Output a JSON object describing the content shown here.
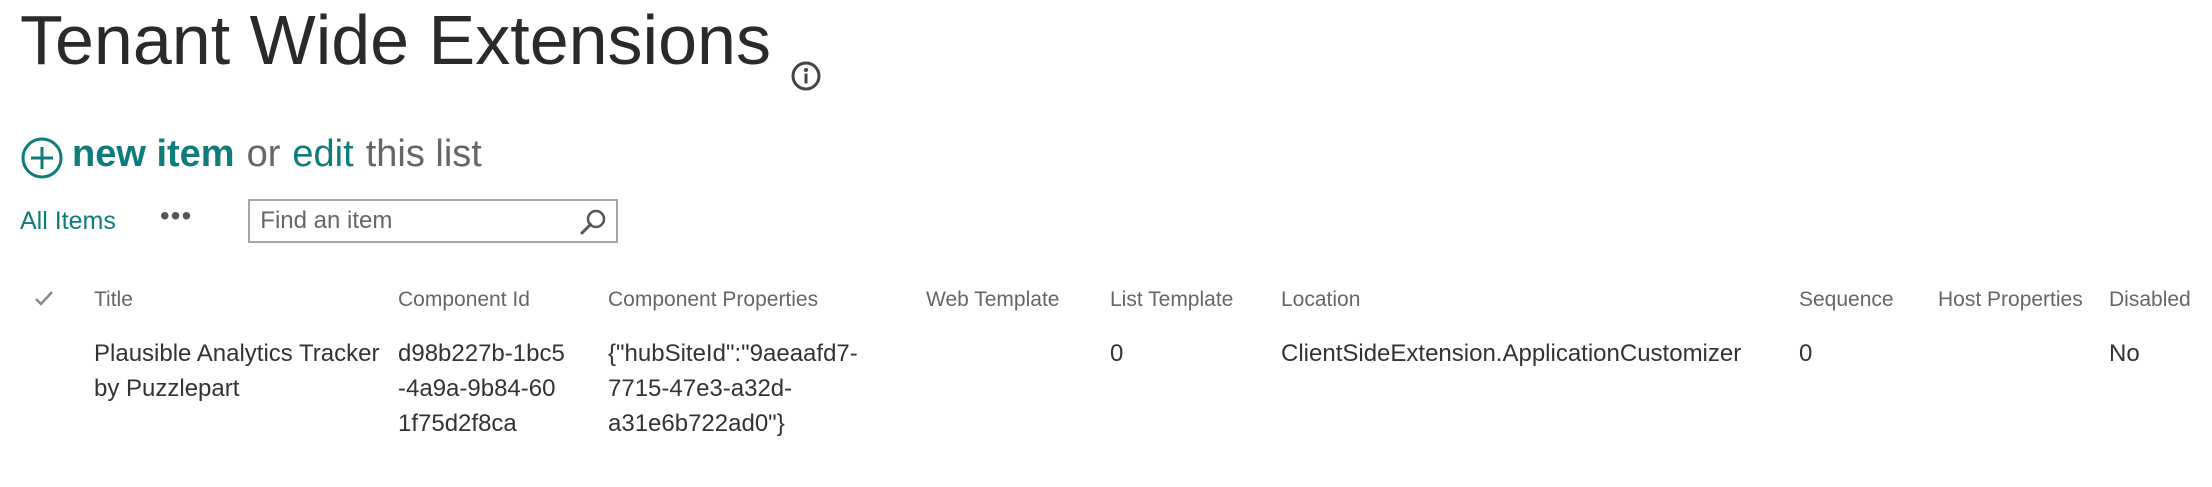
{
  "header": {
    "title": "Tenant Wide Extensions",
    "info_icon": "info-icon"
  },
  "actions": {
    "new_item_label": "new item",
    "or_label": "or",
    "edit_label": "edit",
    "this_list_label": "this list",
    "plus_icon": "plus-circle-icon"
  },
  "views": {
    "current_view": "All Items",
    "more_label": "•••",
    "search": {
      "placeholder": "Find an item",
      "value": "",
      "icon": "search-icon"
    }
  },
  "table": {
    "columns": [
      "Title",
      "Component Id",
      "Component Properties",
      "Web Template",
      "List Template",
      "Location",
      "Sequence",
      "Host Properties",
      "Disabled"
    ],
    "rows": [
      {
        "title": "Plausible Analytics Tracker by Puzzlepart",
        "component_id": "d98b227b-1bc5-4a9a-9b84-601f75d2f8ca",
        "component_properties": "{\"hubSiteId\":\"9aeaafd7-7715-47e3-a32d-a31e6b722ad0\"}",
        "web_template": "",
        "list_template": "0",
        "location": "ClientSideExtension.ApplicationCustomizer",
        "sequence": "0",
        "host_properties": "",
        "disabled": "No"
      }
    ]
  },
  "colors": {
    "accent": "#0f7b7b",
    "muted_text": "#666666",
    "body_text": "#333333"
  }
}
